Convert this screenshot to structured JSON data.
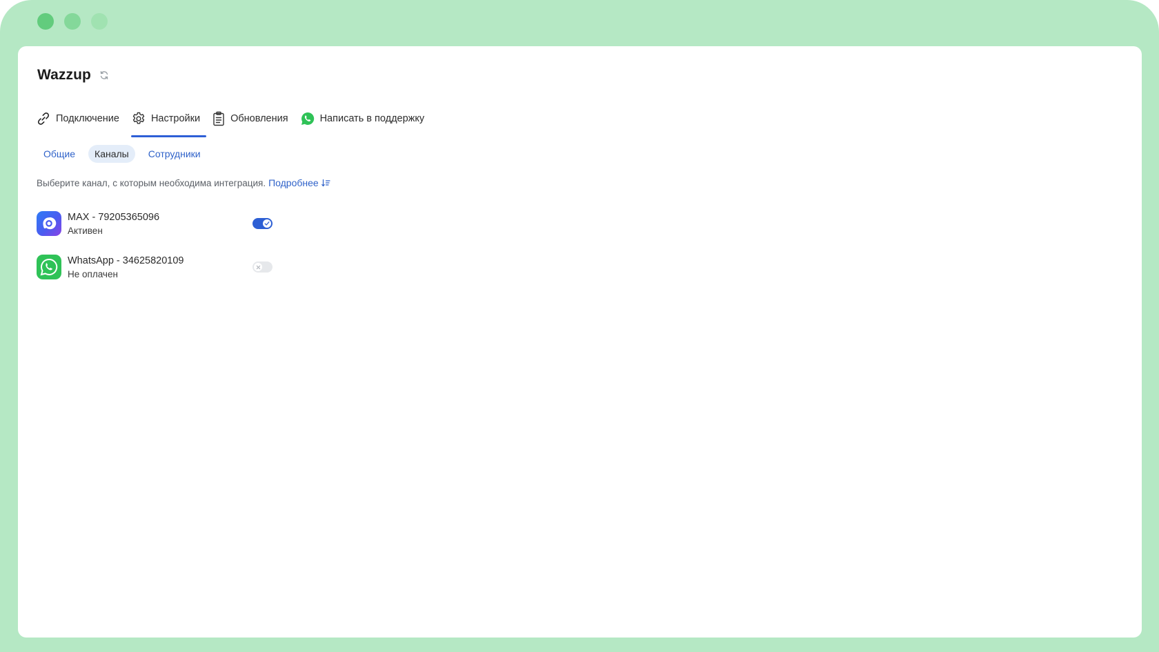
{
  "app": {
    "title": "Wazzup"
  },
  "main_tabs": [
    {
      "label": "Подключение",
      "icon": "link-icon",
      "active": false
    },
    {
      "label": "Настройки",
      "icon": "gear-icon",
      "active": true
    },
    {
      "label": "Обновления",
      "icon": "clipboard-icon",
      "active": false
    },
    {
      "label": "Написать в поддержку",
      "icon": "whatsapp-icon",
      "active": false
    }
  ],
  "sub_tabs": [
    {
      "label": "Общие",
      "active": false
    },
    {
      "label": "Каналы",
      "active": true
    },
    {
      "label": "Сотрудники",
      "active": false
    }
  ],
  "info": {
    "text": "Выберите канал, с которым необходима интеграция.",
    "link": "Подробнее"
  },
  "channels": [
    {
      "name": "MAX - 79205365096",
      "status": "Активен",
      "enabled": true,
      "icon": "max-icon"
    },
    {
      "name": "WhatsApp - 34625820109",
      "status": "Не оплачен",
      "enabled": false,
      "icon": "whatsapp-icon"
    }
  ],
  "colors": {
    "frame": "#b5e8c4",
    "accent": "#2d5fd4",
    "link": "#2f62c9",
    "whatsapp": "#2fc257"
  }
}
